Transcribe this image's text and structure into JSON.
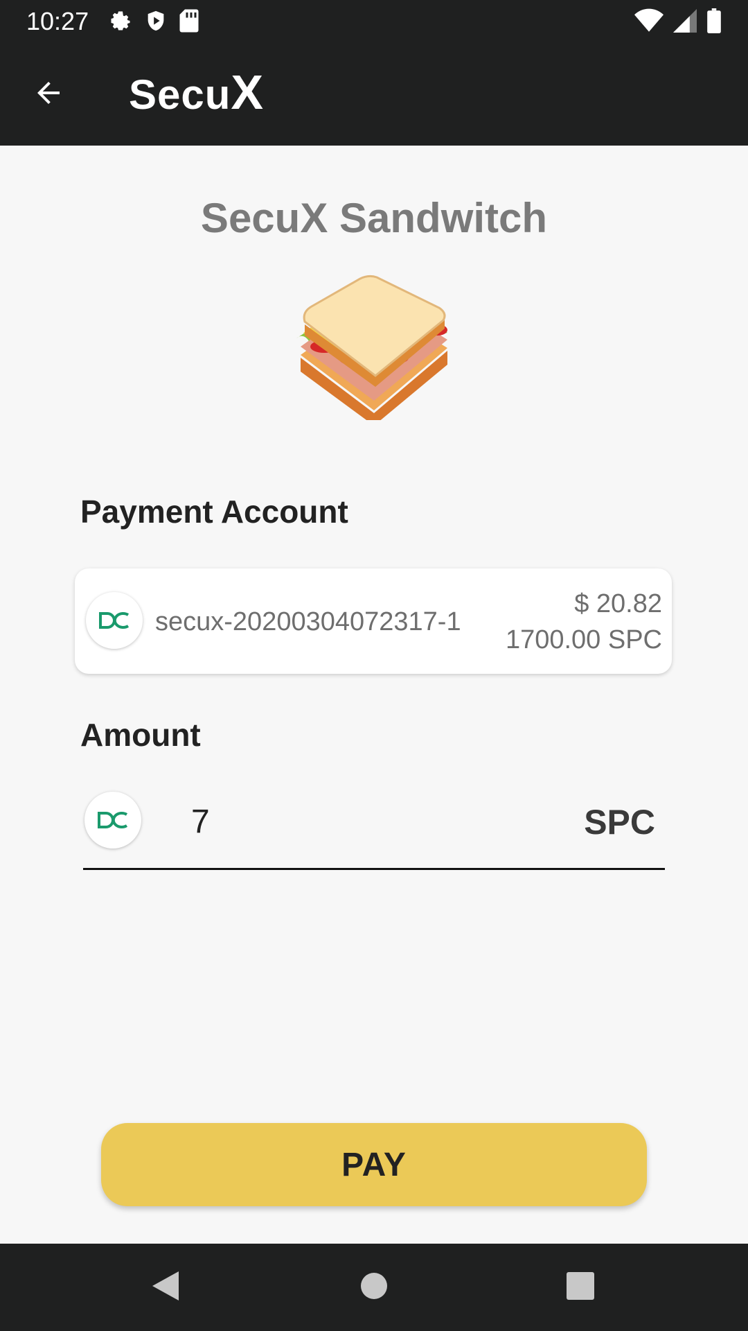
{
  "status_bar": {
    "time": "10:27",
    "left_icons": [
      "gear-icon",
      "shield-play-icon",
      "sd-card-icon"
    ],
    "right_icons": [
      "wifi-icon",
      "cell-signal-icon",
      "battery-icon"
    ]
  },
  "app_bar": {
    "back_icon": "arrow-left-icon",
    "logo_main": "Secu",
    "logo_x": "X"
  },
  "merchant": {
    "title": "SecuX Sandwitch",
    "image_icon": "sandwich-icon"
  },
  "payment_account": {
    "label": "Payment Account",
    "coin_icon": "dc-coin-icon",
    "account_name": "secux-20200304072317-1",
    "balance_usd": "$ 20.82",
    "balance_coin": "1700.00 SPC"
  },
  "amount": {
    "label": "Amount",
    "coin_icon": "dc-coin-icon",
    "value": "7",
    "unit": "SPC"
  },
  "pay_button": {
    "label": "PAY"
  },
  "nav_bar": {
    "icons": [
      "triangle-back-icon",
      "circle-home-icon",
      "square-recents-icon"
    ]
  },
  "colors": {
    "bar_background": "#1f2020",
    "page_background": "#f7f7f7",
    "pay_button": "#ebc957",
    "coin_green": "#1a9a6c"
  }
}
